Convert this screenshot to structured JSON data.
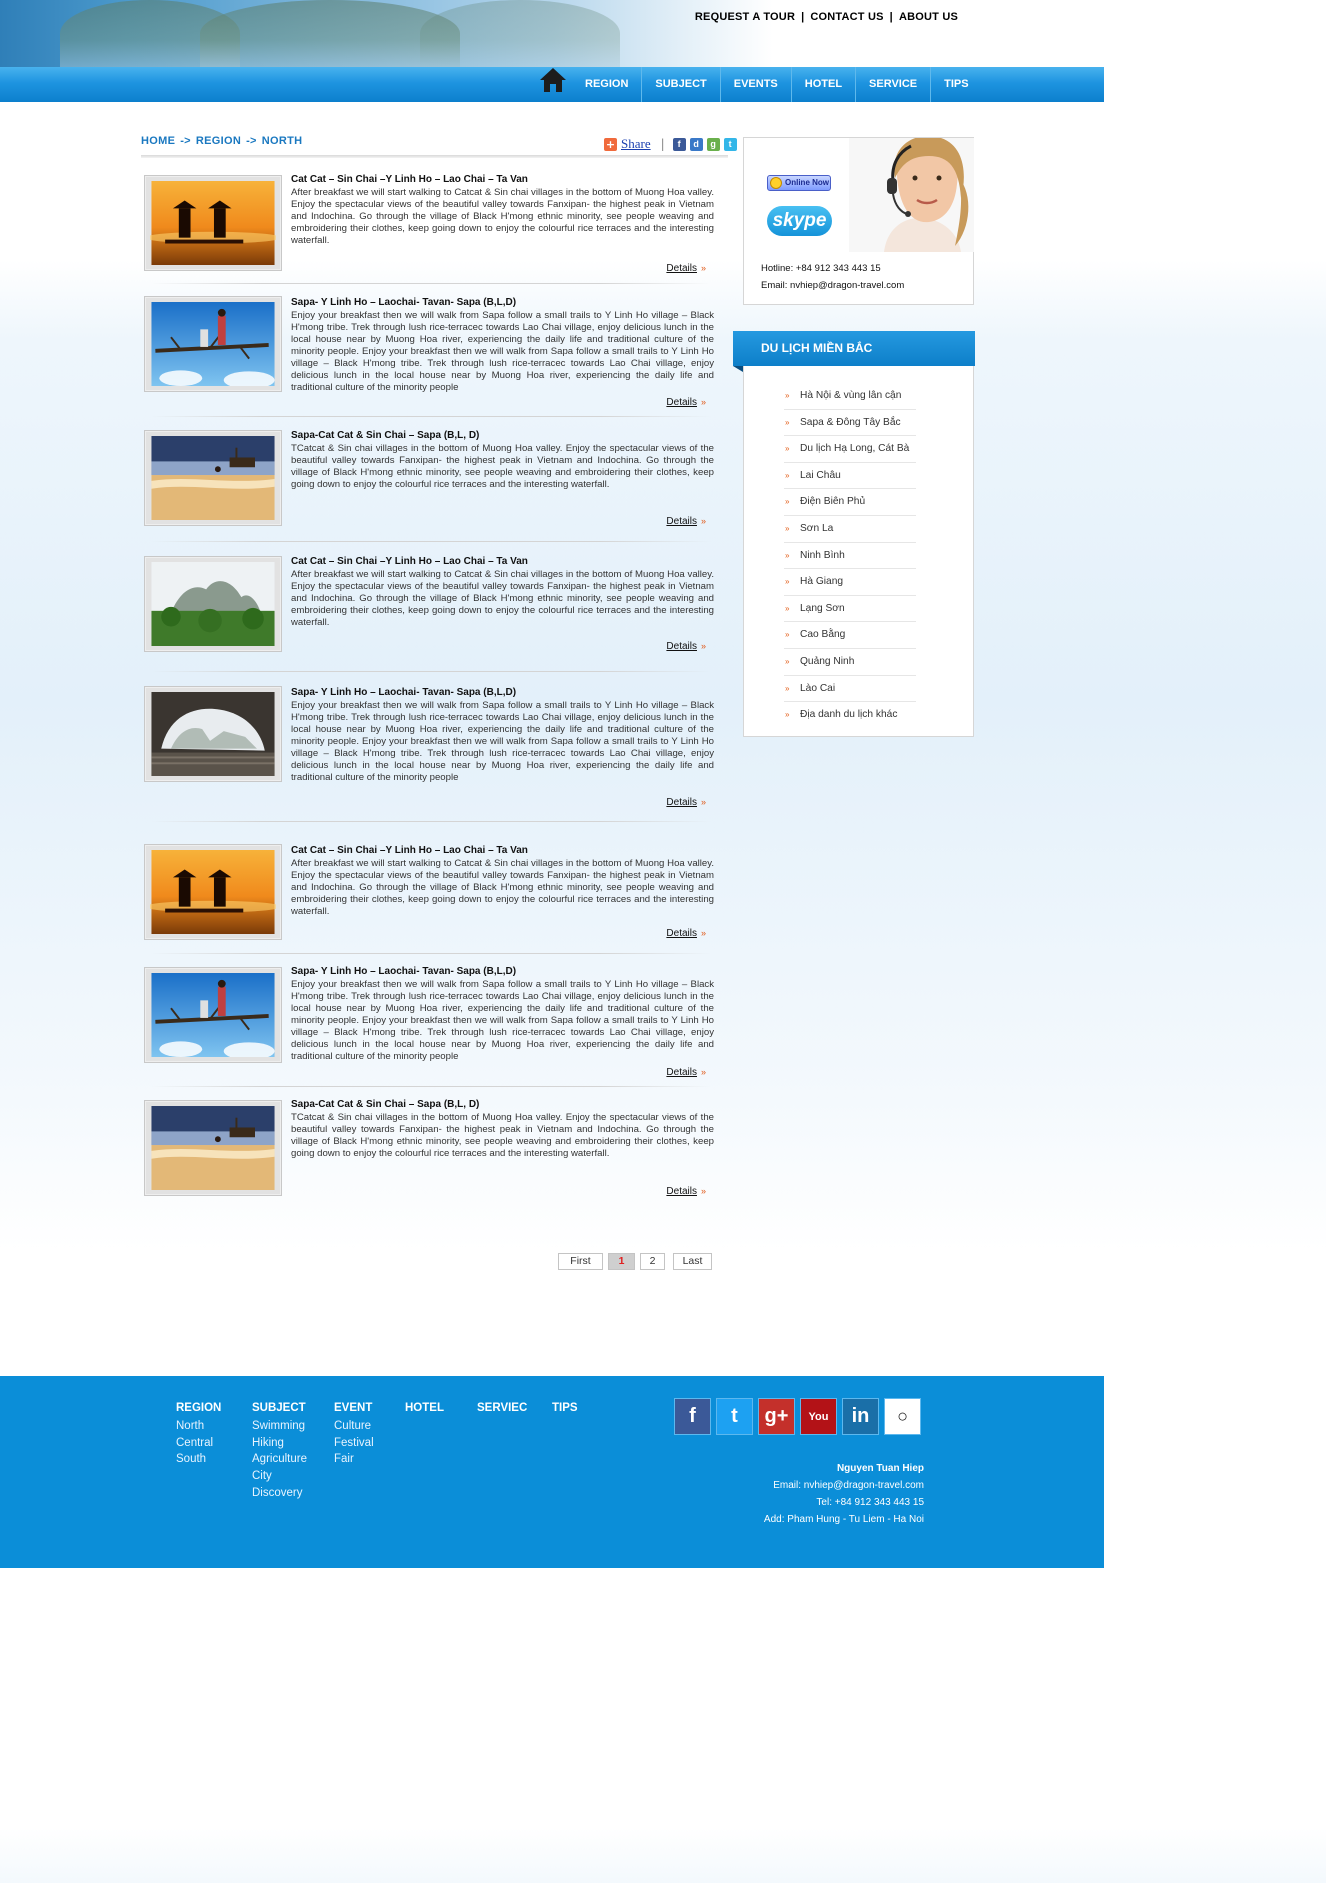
{
  "header": {
    "top_links": [
      "REQUEST A TOUR",
      "CONTACT US",
      "ABOUT US"
    ],
    "nav": [
      "REGION",
      "SUBJECT",
      "EVENTS",
      "HOTEL",
      "SERVICE",
      "TIPS"
    ]
  },
  "breadcrumb": [
    "HOME",
    "REGION",
    "NORTH"
  ],
  "breadcrumb_sep": "->",
  "share": {
    "label": "Share",
    "icons": [
      "facebook-icon",
      "delicious-icon",
      "google-icon",
      "twitter-icon"
    ]
  },
  "tours": [
    {
      "title": "Cat Cat – Sin Chai –Y Linh Ho – Lao Chai – Ta Van",
      "description": "After breakfast we will start walking to Catcat & Sin chai villages in the bottom of Muong Hoa valley. Enjoy the spectacular views of the beautiful valley towards Fanxipan- the highest peak in Vietnam and Indochina. Go through the village of Black H'mong ethnic minority, see people weaving and embroidering their clothes, keep going down to enjoy the colourful rice terraces and the interesting waterfall.",
      "details": "Details",
      "image": "sunset-fishermen"
    },
    {
      "title": "Sapa- Y Linh Ho – Laochai- Tavan- Sapa (B,L,D)",
      "description": "Enjoy your breakfast then we will walk from Sapa follow a small trails to Y Linh Ho village – Black H'mong tribe. Trek through lush rice-terracec towards Lao Chai village, enjoy delicious lunch in the local house near by Muong Hoa river, experiencing the daily life and traditional culture of the minority people. Enjoy your breakfast then we will walk from Sapa follow a small trails to Y Linh Ho village – Black H'mong tribe. Trek through lush rice-terracec towards Lao Chai village, enjoy delicious lunch in the local house near by Muong Hoa river, experiencing the daily life and traditional culture of the minority people",
      "details": "Details",
      "image": "kids-on-branch"
    },
    {
      "title": "Sapa-Cat Cat & Sin Chai – Sapa (B,L, D)",
      "description": "TCatcat & Sin chai villages in the bottom of Muong Hoa valley. Enjoy the spectacular views of the beautiful valley towards Fanxipan- the highest peak in Vietnam and Indochina. Go through the village of Black H'mong ethnic minority, see people weaving and embroidering their clothes, keep going down to enjoy the colourful rice terraces and the interesting waterfall.",
      "details": "Details",
      "image": "beach-boat"
    },
    {
      "title": "Cat Cat – Sin Chai –Y Linh Ho – Lao Chai – Ta Van",
      "description": "After breakfast we will start walking to Catcat & Sin chai villages in the bottom of Muong Hoa valley. Enjoy the spectacular views of the beautiful valley towards Fanxipan- the highest peak in Vietnam and Indochina. Go through the village of Black H'mong ethnic minority, see people weaving and embroidering their clothes, keep going down to enjoy the colourful rice terraces and the interesting waterfall.",
      "details": "Details",
      "image": "limestone-hill"
    },
    {
      "title": "Sapa- Y Linh Ho – Laochai- Tavan- Sapa (B,L,D)",
      "description": "Enjoy your breakfast then we will walk from Sapa follow a small trails to Y Linh Ho village – Black H'mong tribe. Trek through lush rice-terracec towards Lao Chai village, enjoy delicious lunch in the local house near by Muong Hoa river, experiencing the daily life and traditional culture of the minority people. Enjoy your breakfast then we will walk from Sapa follow a small trails to Y Linh Ho village – Black H'mong tribe. Trek through lush rice-terracec towards Lao Chai village, enjoy delicious lunch in the local house near by Muong Hoa river, experiencing the daily life and traditional culture of the minority people",
      "details": "Details",
      "image": "cave"
    },
    {
      "title": "Cat Cat – Sin Chai –Y Linh Ho – Lao Chai – Ta Van",
      "description": "After breakfast we will start walking to Catcat & Sin chai villages in the bottom of Muong Hoa valley. Enjoy the spectacular views of the beautiful valley towards Fanxipan- the highest peak in Vietnam and Indochina. Go through the village of Black H'mong ethnic minority, see people weaving and embroidering their clothes, keep going down to enjoy the colourful rice terraces and the interesting waterfall.",
      "details": "Details",
      "image": "sunset-fishermen"
    },
    {
      "title": "Sapa- Y Linh Ho – Laochai- Tavan- Sapa (B,L,D)",
      "description": "Enjoy your breakfast then we will walk from Sapa follow a small trails to Y Linh Ho village – Black H'mong tribe. Trek through lush rice-terracec towards Lao Chai village, enjoy delicious lunch in the local house near by Muong Hoa river, experiencing the daily life and traditional culture of the minority people. Enjoy your breakfast then we will walk from Sapa follow a small trails to Y Linh Ho village – Black H'mong tribe. Trek through lush rice-terracec towards Lao Chai village, enjoy delicious lunch in the local house near by Muong Hoa river, experiencing the daily life and traditional culture of the minority people",
      "details": "Details",
      "image": "kids-on-branch"
    },
    {
      "title": "Sapa-Cat Cat & Sin Chai – Sapa (B,L, D)",
      "description": "TCatcat & Sin chai villages in the bottom of Muong Hoa valley. Enjoy the spectacular views of the beautiful valley towards Fanxipan- the highest peak in Vietnam and Indochina. Go through the village of Black H'mong ethnic minority, see people weaving and embroidering their clothes, keep going down to enjoy the colourful rice terraces and the interesting waterfall.",
      "details": "Details",
      "image": "beach-boat"
    }
  ],
  "pagination": {
    "first": "First",
    "pages": [
      "1",
      "2"
    ],
    "current": "1",
    "last": "Last"
  },
  "support": {
    "online_label": "Online Now",
    "skype_label": "skype",
    "hotline": "Hotline: +84 912 343 443 15",
    "email": "Email: nvhiep@dragon-travel.com"
  },
  "region_box": {
    "title": "DU LỊCH MIỀN BẮC",
    "items": [
      "Hà Nội & vùng lân cận",
      "Sapa & Đông Tây Bắc",
      "Du lịch Hạ Long, Cát Bà",
      "Lai Châu",
      "Điện Biên Phủ",
      "Sơn La",
      "Ninh Bình",
      "Hà Giang",
      "Lạng Sơn",
      "Cao Bằng",
      "Quảng  Ninh",
      "Lào Cai",
      "Địa danh du lịch khác"
    ]
  },
  "footer": {
    "columns": [
      {
        "heading": "REGION",
        "links": [
          "North",
          "Central",
          "South"
        ]
      },
      {
        "heading": "SUBJECT",
        "links": [
          "Swimming",
          "Hiking",
          "Agriculture",
          "City",
          "Discovery"
        ]
      },
      {
        "heading": "EVENT",
        "links": [
          "Culture",
          "Festival",
          "Fair"
        ]
      },
      {
        "heading": "HOTEL",
        "links": []
      },
      {
        "heading": "SERVIEC",
        "links": []
      },
      {
        "heading": "TIPS",
        "links": []
      }
    ],
    "social": [
      {
        "icon": "facebook-icon",
        "glyph": "f",
        "color": "#3b5998"
      },
      {
        "icon": "twitter-icon",
        "glyph": "t",
        "color": "#1da1f2"
      },
      {
        "icon": "googleplus-icon",
        "glyph": "g+",
        "color": "#c4302b"
      },
      {
        "icon": "youtube-icon",
        "glyph": "You",
        "color": "#b31217"
      },
      {
        "icon": "linkedin-icon",
        "glyph": "in",
        "color": "#1a6fa8"
      },
      {
        "icon": "weibo-icon",
        "glyph": "○",
        "color": "#ffffff"
      }
    ],
    "contact": {
      "name": "Nguyen Tuan Hiep",
      "email": "Email: nvhiep@dragon-travel.com",
      "tel": "Tel: +84 912 343 443 15",
      "address": "Add: Pham Hung - Tu Liem - Ha Noi"
    }
  }
}
